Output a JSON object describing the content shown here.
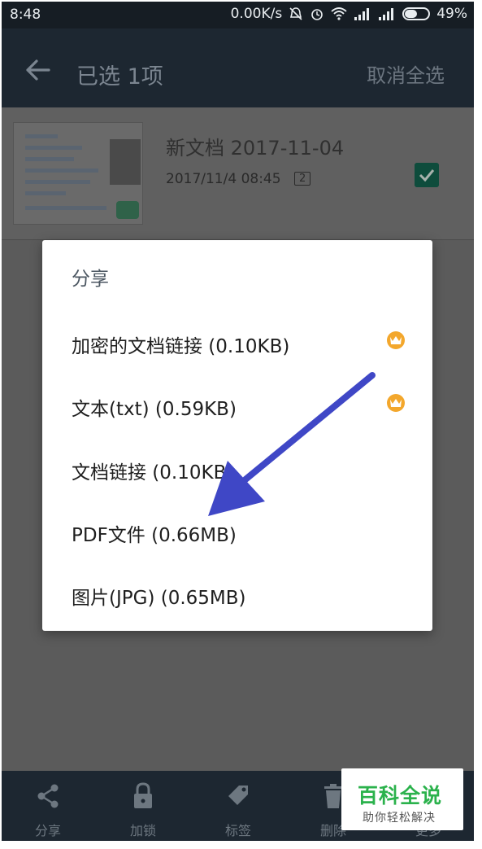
{
  "status_bar": {
    "time": "8:48",
    "net_speed": "0.00K/s",
    "battery": "49%",
    "battery_level": 0.49
  },
  "app_bar": {
    "title": "已选 1项",
    "cancel_all": "取消全选"
  },
  "document": {
    "title": "新文档 2017-11-04",
    "date": "2017/11/4 08:45",
    "page_count": "2",
    "checked": true
  },
  "share_dialog": {
    "title": "分享",
    "options": [
      {
        "label": "加密的文档链接 (0.10KB)",
        "premium": true
      },
      {
        "label": "文本(txt) (0.59KB)",
        "premium": true
      },
      {
        "label": "文档链接 (0.10KB)",
        "premium": false
      },
      {
        "label": "PDF文件 (0.66MB)",
        "premium": false
      },
      {
        "label": "图片(JPG) (0.65MB)",
        "premium": false
      }
    ]
  },
  "bottom_bar": {
    "tabs": [
      {
        "label": "分享",
        "icon": "share-icon"
      },
      {
        "label": "加锁",
        "icon": "lock-icon"
      },
      {
        "label": "标签",
        "icon": "tag-icon"
      },
      {
        "label": "删除",
        "icon": "trash-icon"
      },
      {
        "label": "更多",
        "icon": "more-icon"
      }
    ]
  },
  "watermark": {
    "title": "百科全说",
    "subtitle": "助你轻松解决"
  },
  "colors": {
    "app_bar": "#1d2731",
    "checkbox": "#0e4c3c",
    "crown": "#f3a72c",
    "arrow": "#3f47c6",
    "watermark_green": "#2bb24c"
  }
}
